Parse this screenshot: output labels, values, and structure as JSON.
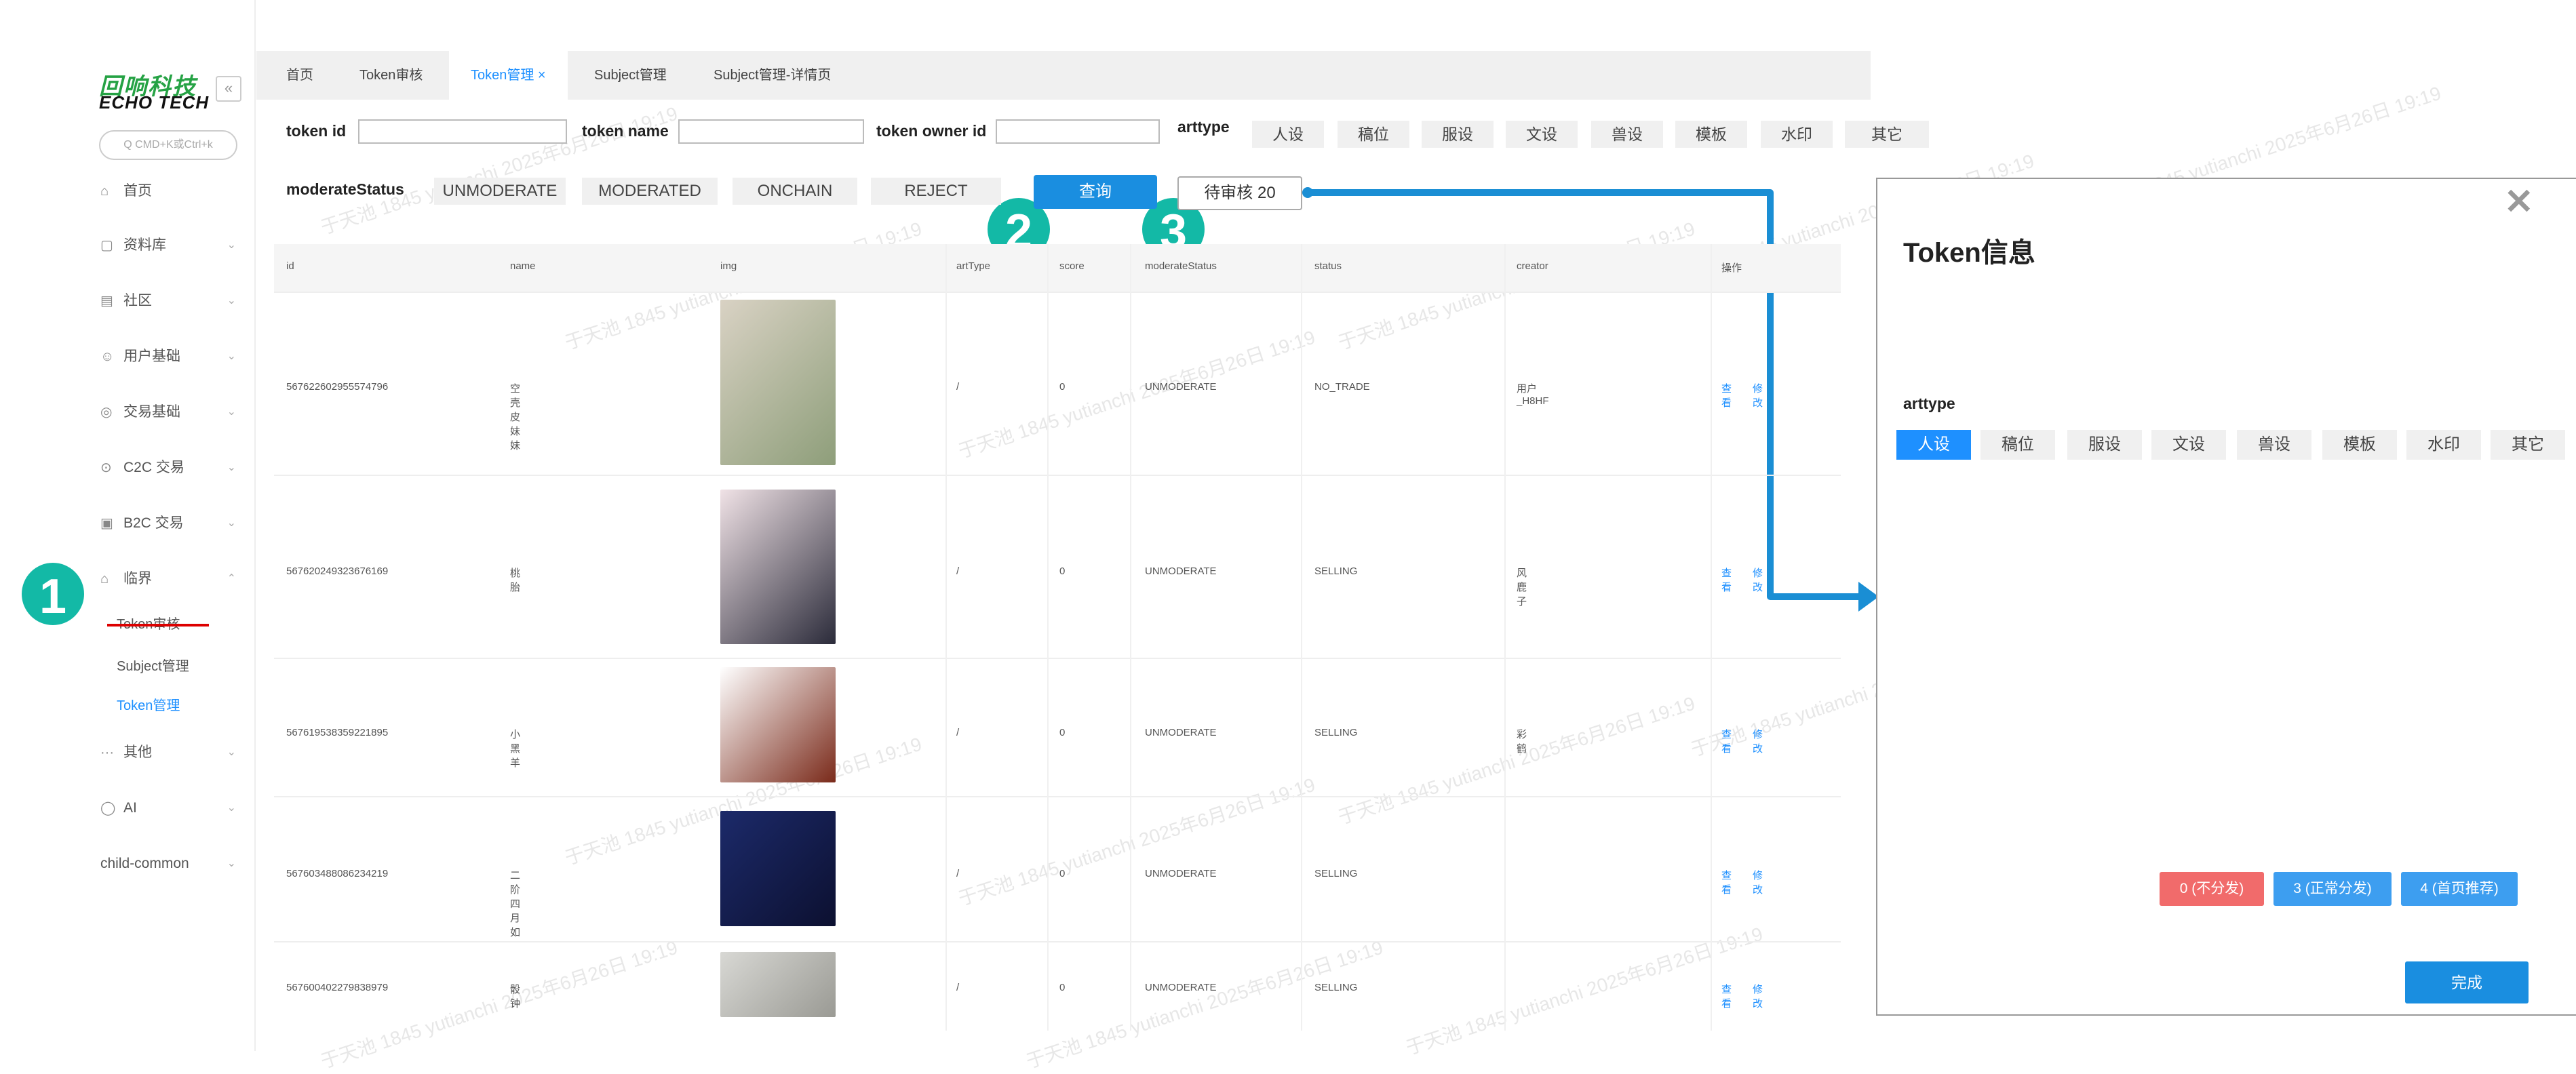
{
  "sidebar": {
    "logo_cn": "回响科技",
    "logo_en": "ECHO TECH",
    "collapse": "«",
    "search_placeholder": "Q CMD+K或Ctrl+k",
    "menu": [
      {
        "label": "首页",
        "icon": "house-icon",
        "glyph": "⌂"
      },
      {
        "label": "资料库",
        "icon": "folder-icon",
        "glyph": "▢"
      },
      {
        "label": "社区",
        "icon": "community-icon",
        "glyph": "▤"
      },
      {
        "label": "用户基础",
        "icon": "user-icon",
        "glyph": "☺"
      },
      {
        "label": "交易基础",
        "icon": "database-icon",
        "glyph": "◎"
      },
      {
        "label": "C2C 交易",
        "icon": "exchange-icon",
        "glyph": "⊙"
      },
      {
        "label": "B2C 交易",
        "icon": "bag-icon",
        "glyph": "▣"
      },
      {
        "label": "临界",
        "icon": "bank-icon",
        "glyph": "⌂"
      },
      {
        "label": "其他",
        "icon": "more-icon",
        "glyph": "···"
      },
      {
        "label": "AI",
        "icon": "ai-icon",
        "glyph": "◯"
      },
      {
        "label": "child-common",
        "icon": "",
        "glyph": ""
      }
    ],
    "submenu": [
      "Token审核",
      "Subject管理",
      "Token管理"
    ]
  },
  "annotations": {
    "one": "1",
    "two": "2",
    "three": "3"
  },
  "tabs": [
    "首页",
    "Token审核",
    "Token管理 ×",
    "Subject管理",
    "Subject管理-详情页"
  ],
  "filters": {
    "token_id_label": "token id",
    "token_name_label": "token name",
    "token_owner_label": "token owner id",
    "arttype_label": "arttype",
    "arttypes": [
      "人设",
      "稿位",
      "服设",
      "文设",
      "兽设",
      "模板",
      "水印",
      "其它"
    ],
    "moderate_label": "moderateStatus",
    "statuses": [
      "UNMODERATE",
      "MODERATED",
      "ONCHAIN",
      "REJECT"
    ],
    "query_btn": "查询",
    "pending_btn": "待审核 20"
  },
  "table": {
    "headers": [
      "id",
      "name",
      "img",
      "artType",
      "score",
      "moderateStatus",
      "status",
      "creator",
      "操作"
    ],
    "rows": [
      {
        "id": "567622602955574796",
        "name": "空壳皮妹妹",
        "artType": "/",
        "score": "0",
        "moderate": "UNMODERATE",
        "status": "NO_TRADE",
        "creator": "用户_H8HF",
        "view": "查看",
        "edit": "修改"
      },
      {
        "id": "567620249323676169",
        "name": "桃胎",
        "artType": "/",
        "score": "0",
        "moderate": "UNMODERATE",
        "status": "SELLING",
        "creator": "风鹿子",
        "view": "查看",
        "edit": "修改"
      },
      {
        "id": "567619538359221895",
        "name": "小黑羊",
        "artType": "/",
        "score": "0",
        "moderate": "UNMODERATE",
        "status": "SELLING",
        "creator": "彩鹤",
        "view": "查看",
        "edit": "修改"
      },
      {
        "id": "567603488086234219",
        "name": "二阶 四月如",
        "artType": "/",
        "score": "0",
        "moderate": "UNMODERATE",
        "status": "SELLING",
        "creator": "",
        "view": "查看",
        "edit": "修改"
      },
      {
        "id": "567600402279838979",
        "name": "骰钟",
        "artType": "/",
        "score": "0",
        "moderate": "UNMODERATE",
        "status": "SELLING",
        "creator": "",
        "view": "查看",
        "edit": "修改"
      }
    ]
  },
  "dialog": {
    "title": "Token信息",
    "close": "✕",
    "arttype_label": "arttype",
    "arttypes": [
      "人设",
      "稿位",
      "服设",
      "文设",
      "兽设",
      "模板",
      "水印",
      "其它"
    ],
    "btn_0": "0 (不分发)",
    "btn_3": "3 (正常分发)",
    "btn_4": "4 (首页推荐)",
    "done": "完成"
  },
  "watermark": "于天池 1845 yutianchi 2025年6月26日 19:19",
  "colors": {
    "accent": "#1e90ff",
    "teal": "#13b9a6",
    "red": "#f16b6b",
    "logo_green": "#25a244"
  }
}
